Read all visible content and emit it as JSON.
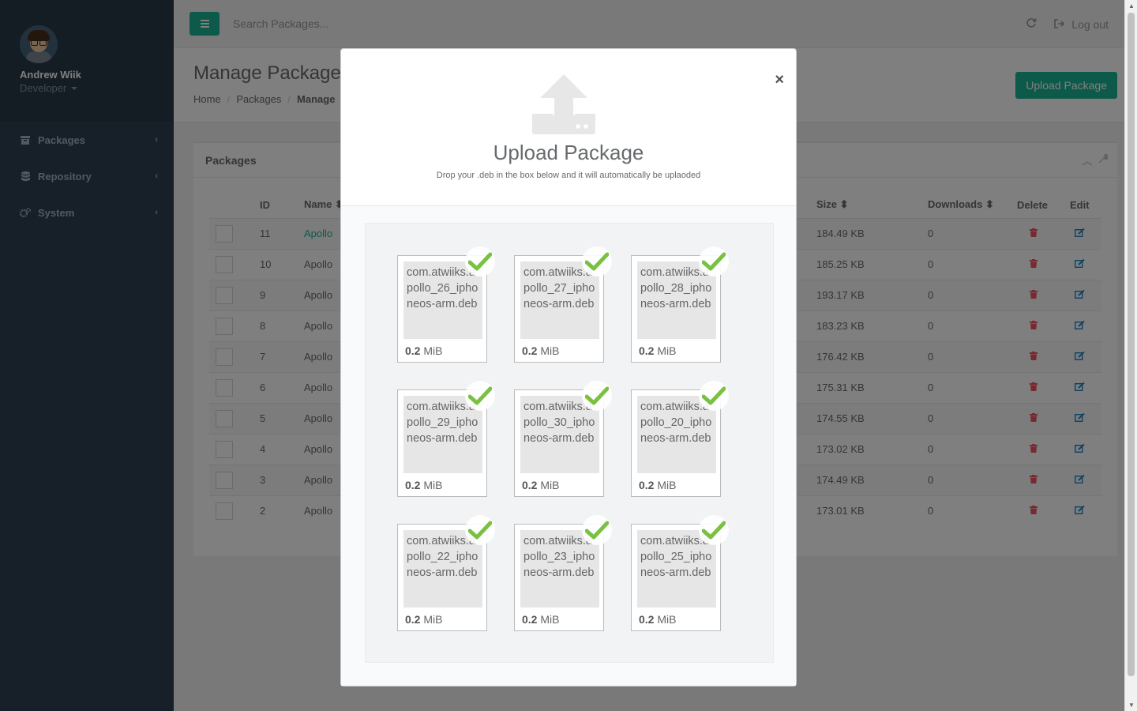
{
  "sidebar": {
    "profile_name": "Andrew Wiik",
    "profile_role": "Developer",
    "items": [
      {
        "label": "Packages",
        "icon": "archive-icon"
      },
      {
        "label": "Repository",
        "icon": "database-icon"
      },
      {
        "label": "System",
        "icon": "cogs-icon"
      }
    ]
  },
  "topbar": {
    "search_placeholder": "Search Packages...",
    "logout_label": "Log out"
  },
  "heading": {
    "title": "Manage Packages",
    "breadcrumb": [
      "Home",
      "Packages",
      "Manage"
    ],
    "upload_button": "Upload Package"
  },
  "panel": {
    "title": "Packages",
    "columns": {
      "id": "ID",
      "name": "Name",
      "size": "Size",
      "downloads": "Downloads",
      "delete": "Delete",
      "edit": "Edit"
    },
    "rows": [
      {
        "id": "11",
        "name": "Apollo",
        "size": "184.49 KB",
        "downloads": "0"
      },
      {
        "id": "10",
        "name": "Apollo",
        "size": "185.25 KB",
        "downloads": "0"
      },
      {
        "id": "9",
        "name": "Apollo",
        "size": "193.17 KB",
        "downloads": "0"
      },
      {
        "id": "8",
        "name": "Apollo",
        "size": "183.23 KB",
        "downloads": "0"
      },
      {
        "id": "7",
        "name": "Apollo",
        "size": "176.42 KB",
        "downloads": "0"
      },
      {
        "id": "6",
        "name": "Apollo",
        "size": "175.31 KB",
        "downloads": "0"
      },
      {
        "id": "5",
        "name": "Apollo",
        "size": "174.55 KB",
        "downloads": "0"
      },
      {
        "id": "4",
        "name": "Apollo",
        "size": "173.02 KB",
        "downloads": "0"
      },
      {
        "id": "3",
        "name": "Apollo",
        "size": "174.49 KB",
        "downloads": "0"
      },
      {
        "id": "2",
        "name": "Apollo",
        "size": "173.01 KB",
        "downloads": "0"
      }
    ]
  },
  "modal": {
    "title": "Upload Package",
    "subtitle": "Drop your .deb in the box below and it will automatically be uplaoded",
    "close_label": "×",
    "files": [
      {
        "name": "com.atwiiks.apollo_26_iphoneos-arm.deb",
        "size_value": "0.2",
        "size_unit": "MiB"
      },
      {
        "name": "com.atwiiks.apollo_27_iphoneos-arm.deb",
        "size_value": "0.2",
        "size_unit": "MiB"
      },
      {
        "name": "com.atwiiks.apollo_28_iphoneos-arm.deb",
        "size_value": "0.2",
        "size_unit": "MiB"
      },
      {
        "name": "com.atwiiks.apollo_29_iphoneos-arm.deb",
        "size_value": "0.2",
        "size_unit": "MiB"
      },
      {
        "name": "com.atwiiks.apollo_30_iphoneos-arm.deb",
        "size_value": "0.2",
        "size_unit": "MiB"
      },
      {
        "name": "com.atwiiks.apollo_20_iphoneos-arm.deb",
        "size_value": "0.2",
        "size_unit": "MiB"
      },
      {
        "name": "com.atwiiks.apollo_22_iphoneos-arm.deb",
        "size_value": "0.2",
        "size_unit": "MiB"
      },
      {
        "name": "com.atwiiks.apollo_23_iphoneos-arm.deb",
        "size_value": "0.2",
        "size_unit": "MiB"
      },
      {
        "name": "com.atwiiks.apollo_25_iphoneos-arm.deb",
        "size_value": "0.2",
        "size_unit": "MiB"
      }
    ]
  },
  "colors": {
    "sidebar_bg": "#2f4050",
    "accent": "#1ab394",
    "danger": "#ed5565",
    "link": "#1c84c6",
    "check": "#7ac142"
  }
}
